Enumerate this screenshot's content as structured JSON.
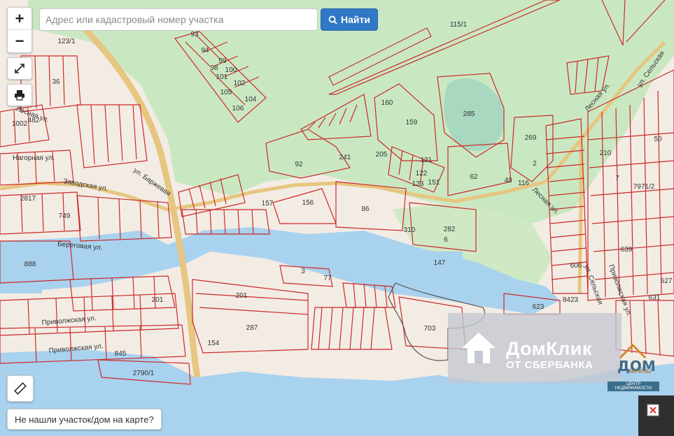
{
  "search": {
    "placeholder": "Адрес или кадастровый номер участка"
  },
  "toolbar": {
    "find_label": "Найти",
    "zoom_in": "+",
    "zoom_out": "−"
  },
  "help": {
    "not_found": "Не нашли участок/дом на карте?"
  },
  "banner": {
    "title": "ДомКлик",
    "subtitle": "ОТ СБЕРБАНКА"
  },
  "partner": {
    "brand": "ДОМ",
    "tagline": "мечты",
    "caption": "ЦЕНТР НЕДВИЖИМОСТИ"
  },
  "streets": [
    "Лесная ул.",
    "Нагорная ул.",
    "Заводская ул.",
    "ул. Баржевая",
    "Береговая ул.",
    "Приволжская ул.",
    "Приволжская ул.",
    "Лесная ул.",
    "ул. Сельская",
    "Лесная ул.",
    "ул. Сельская",
    "Приволжская ул."
  ],
  "parcels": [
    "115/1",
    "123/1",
    "93",
    "94",
    "99",
    "100",
    "98",
    "101",
    "102",
    "105",
    "104",
    "106",
    "36",
    "1002",
    "482",
    "160",
    "159",
    "285",
    "269",
    "50",
    "2817",
    "749",
    "241",
    "205",
    "92",
    "121",
    "122",
    "123",
    "151",
    "62",
    "48",
    "116",
    "2",
    "210",
    "7",
    "7971/2",
    "156",
    "157",
    "86",
    "310",
    "282",
    "6",
    "147",
    "639",
    "606",
    "627",
    "888",
    "3",
    "77",
    "201",
    "201",
    "287",
    "8423",
    "623",
    "631",
    "703",
    "154",
    "845",
    "2790/1"
  ],
  "colors": {
    "water": "#a9d2ee",
    "forest": "#c9e8c2",
    "land": "#f3ece4",
    "parcel": "#cc2a2a",
    "road": "#e6c680",
    "accent": "#3178c6"
  }
}
